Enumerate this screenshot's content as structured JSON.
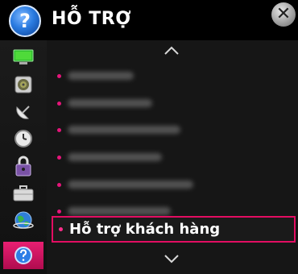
{
  "header": {
    "title": "HỖ TRỢ",
    "help_icon_glyph": "?",
    "close_glyph": "✕"
  },
  "sidebar": {
    "items": [
      {
        "icon": "tv-screen-icon"
      },
      {
        "icon": "speaker-icon"
      },
      {
        "icon": "satellite-dish-icon"
      },
      {
        "icon": "clock-icon"
      },
      {
        "icon": "padlock-icon"
      },
      {
        "icon": "briefcase-icon"
      },
      {
        "icon": "globe-icon"
      },
      {
        "icon": "help-icon",
        "active": true
      }
    ]
  },
  "menu": {
    "items": [
      {
        "label": "",
        "blurred": true
      },
      {
        "label": "",
        "blurred": true
      },
      {
        "label": "",
        "blurred": true
      },
      {
        "label": "",
        "blurred": true
      },
      {
        "label": "",
        "blurred": true
      },
      {
        "label": "",
        "blurred": true
      },
      {
        "label": "Hỗ trợ khách hàng",
        "selected": true
      }
    ],
    "scroll_up_icon": "chevron-up-icon",
    "scroll_down_icon": "chevron-down-icon"
  },
  "colors": {
    "accent": "#e20d62",
    "bullet": "#e5157a",
    "background": "#161616"
  }
}
